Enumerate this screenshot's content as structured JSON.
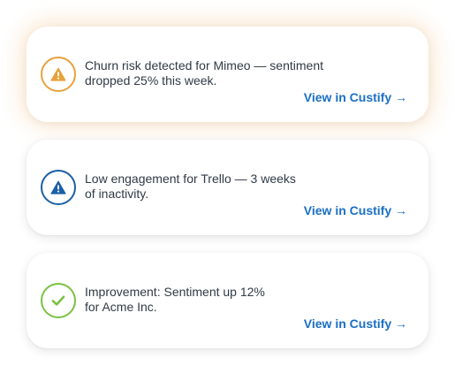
{
  "cards": [
    {
      "status": "warning",
      "icon": "warning-triangle-icon",
      "color": "#E6A23C",
      "line1": "Churn risk detected for Mimeo — sentiment",
      "line2": "dropped 25% this week.",
      "link": "View in Custify →"
    },
    {
      "status": "info",
      "icon": "warning-triangle-icon",
      "color": "#1C5FA6",
      "line1": "Low engagement for Trello — 3 weeks",
      "line2": "of inactivity.",
      "link": "View in Custify →"
    },
    {
      "status": "success",
      "icon": "checkmark-icon",
      "color": "#7AC143",
      "line1": "Improvement: Sentiment up 12%",
      "line2": "for Acme Inc.",
      "link": "View in Custify →"
    }
  ]
}
